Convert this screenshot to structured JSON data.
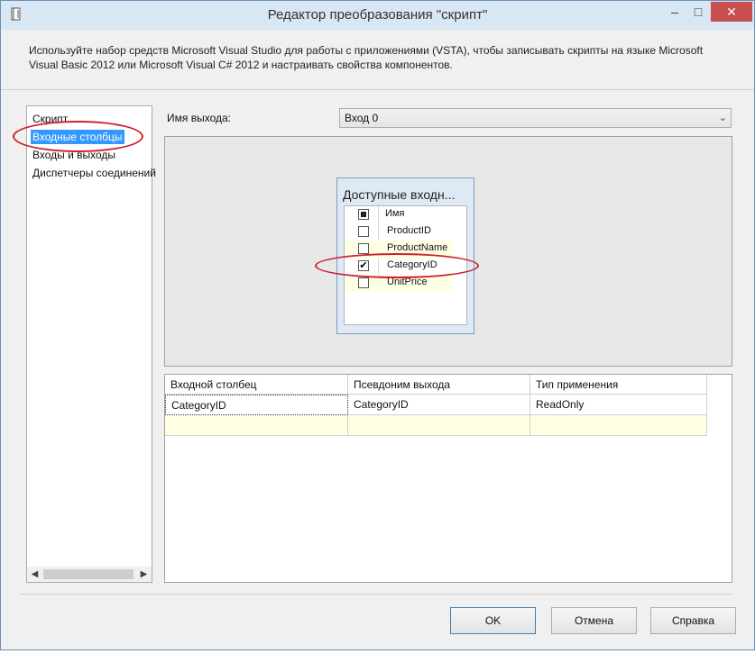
{
  "window": {
    "title": "Редактор преобразования \"скрипт\""
  },
  "titlebar": {
    "minimize": "–",
    "maximize": "□",
    "close": "✕"
  },
  "description": "Используйте набор средств Microsoft Visual Studio для работы с приложениями (VSTA), чтобы записывать скрипты на языке Microsoft Visual Basic 2012 или Microsoft Visual C# 2012 и настраивать свойства компонентов.",
  "nav": {
    "items": [
      {
        "label": "Скрипт"
      },
      {
        "label": "Входные столбцы",
        "selected": true
      },
      {
        "label": "Входы и выходы"
      },
      {
        "label": "Диспетчеры соединений"
      }
    ],
    "scroll_left": "◀",
    "scroll_right": "▶"
  },
  "output": {
    "label": "Имя выхода:",
    "selected_value": "Вход 0",
    "chevron": "⌄"
  },
  "available_columns": {
    "title": "Доступные входн...",
    "header": "Имя",
    "rows": [
      {
        "name": "ProductID",
        "checked": false
      },
      {
        "name": "ProductName",
        "checked": false
      },
      {
        "name": "CategoryID",
        "checked": true
      },
      {
        "name": "UnitPrice",
        "checked": false
      }
    ],
    "check_mark": "✔"
  },
  "grid": {
    "headers": [
      "Входной столбец",
      "Псевдоним выхода",
      "Тип применения"
    ],
    "rows": [
      [
        "CategoryID",
        "CategoryID",
        "ReadOnly"
      ]
    ]
  },
  "buttons": {
    "ok": "OK",
    "cancel": "Отмена",
    "help": "Справка"
  },
  "colors": {
    "annotation": "#cc1f2d",
    "selection": "#3399ff",
    "titlebar": "#d9e6f3",
    "close": "#c74f50"
  }
}
